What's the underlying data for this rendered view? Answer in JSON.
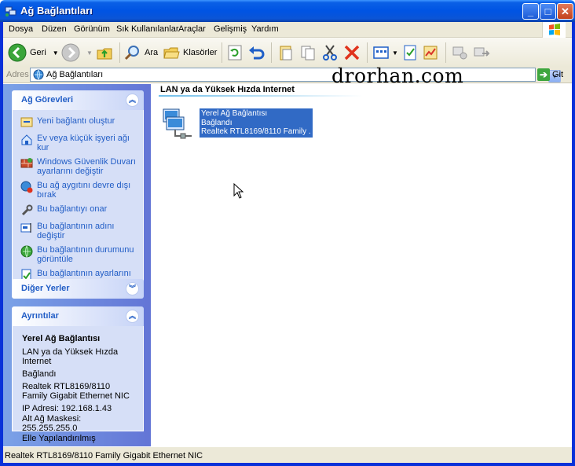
{
  "window": {
    "title": "Ağ Bağlantıları",
    "minimize_label": "_",
    "maximize_label": "□",
    "close_label": "✕"
  },
  "menu": [
    "Dosya",
    "Düzen",
    "Görünüm",
    "Sık Kullanılanlar",
    "Araçlar",
    "Gelişmiş",
    "Yardım"
  ],
  "toolbar": {
    "back_label": "Geri",
    "search_label": "Ara",
    "folders_label": "Klasörler"
  },
  "address": {
    "label": "Adres",
    "value": "Ağ Bağlantıları",
    "go_label": "Git"
  },
  "watermark": "drorhan.com",
  "sidebar": {
    "tasks": {
      "title": "Ağ Görevleri",
      "items": [
        {
          "label": "Yeni bağlantı oluştur",
          "icon": "new-connection-icon"
        },
        {
          "label": "Ev veya küçük işyeri ağı kur",
          "icon": "home-network-icon"
        },
        {
          "label": "Windows Güvenlik Duvarı ayarlarını değiştir",
          "icon": "firewall-icon"
        },
        {
          "label": "Bu ağ aygıtını devre dışı bırak",
          "icon": "disable-device-icon"
        },
        {
          "label": "Bu bağlantıyı onar",
          "icon": "repair-icon"
        },
        {
          "label": "Bu bağlantının adını değiştir",
          "icon": "rename-icon"
        },
        {
          "label": "Bu bağlantının durumunu görüntüle",
          "icon": "status-icon"
        },
        {
          "label": "Bu bağlantının ayarlarını değiştir",
          "icon": "settings-icon"
        }
      ]
    },
    "other_places": {
      "title": "Diğer Yerler"
    },
    "details": {
      "title": "Ayrıntılar",
      "name": "Yerel Ağ Bağlantısı",
      "lines": [
        "LAN ya da Yüksek Hızda Internet",
        "Bağlandı",
        "Realtek RTL8169/8110 Family Gigabit Ethernet NIC",
        "IP Adresi: 192.168.1.43",
        "Alt Ağ Maskesi: 255.255.255.0",
        "Elle Yapılandırılmış"
      ]
    }
  },
  "content": {
    "group_title": "LAN ya da Yüksek Hızda Internet",
    "connection": {
      "name": "Yerel Ağ Bağlantısı",
      "status": "Bağlandı",
      "device": "Realtek RTL8169/8110 Family ..."
    }
  },
  "status_bar": {
    "text": "Realtek RTL8169/8110 Family Gigabit Ethernet NIC"
  },
  "colors": {
    "titlebar": "#0054e3",
    "taskpane": "#6f8fe0",
    "link": "#215dc6",
    "selection": "#316ac5"
  }
}
